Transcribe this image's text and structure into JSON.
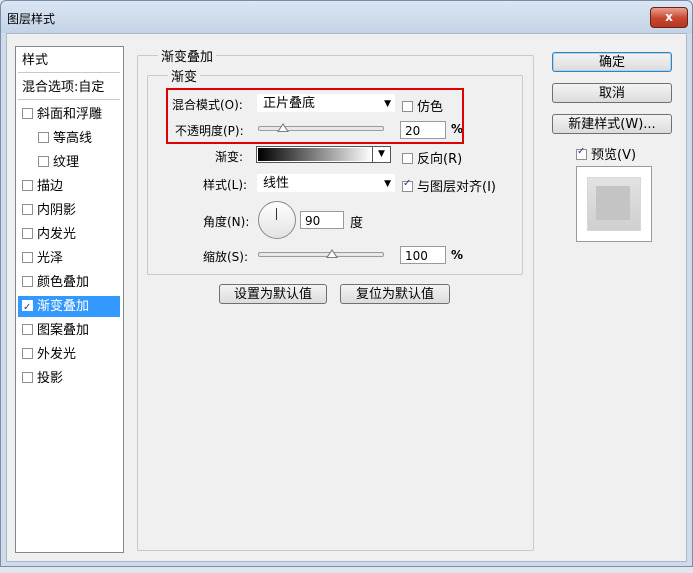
{
  "window": {
    "title": "图层样式",
    "close_label": "x"
  },
  "styles_list": {
    "header": "样式",
    "blend_options": "混合选项:自定",
    "items": [
      {
        "label": "斜面和浮雕",
        "checked": false
      },
      {
        "label": "等高线",
        "checked": false
      },
      {
        "label": "纹理",
        "checked": false
      },
      {
        "label": "描边",
        "checked": false
      },
      {
        "label": "内阴影",
        "checked": false
      },
      {
        "label": "内发光",
        "checked": false
      },
      {
        "label": "光泽",
        "checked": false
      },
      {
        "label": "颜色叠加",
        "checked": false
      },
      {
        "label": "渐变叠加",
        "checked": true
      },
      {
        "label": "图案叠加",
        "checked": false
      },
      {
        "label": "外发光",
        "checked": false
      },
      {
        "label": "投影",
        "checked": false
      }
    ]
  },
  "panel": {
    "group_title": "渐变叠加",
    "subgroup_title": "渐变",
    "blend_mode_label": "混合模式(O):",
    "blend_mode_value": "正片叠底",
    "dither_label": "仿色",
    "opacity_label": "不透明度(P):",
    "opacity_value": "20",
    "percent": "%",
    "gradient_label": "渐变:",
    "reverse_label": "反向(R)",
    "style_label": "样式(L):",
    "style_value": "线性",
    "align_label": "与图层对齐(I)",
    "angle_label": "角度(N):",
    "angle_value": "90",
    "angle_unit": "度",
    "scale_label": "缩放(S):",
    "scale_value": "100",
    "make_default": "设置为默认值",
    "reset_default": "复位为默认值",
    "opacity_fraction": 0.2,
    "scale_fraction": 0.6
  },
  "buttons": {
    "ok": "确定",
    "cancel": "取消",
    "new_style": "新建样式(W)...",
    "preview_label": "预览(V)"
  }
}
